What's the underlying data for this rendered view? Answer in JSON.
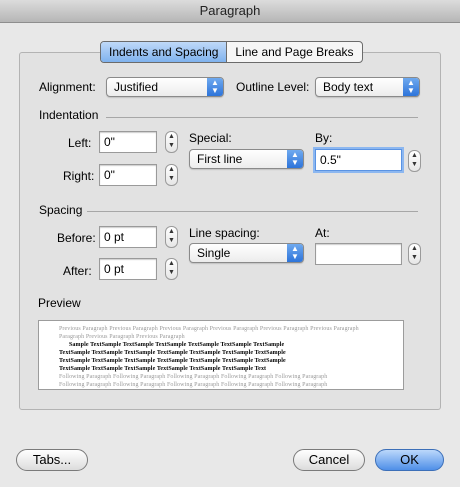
{
  "window": {
    "title": "Paragraph"
  },
  "tabs": [
    {
      "label": "Indents and Spacing",
      "selected": true
    },
    {
      "label": "Line and Page Breaks",
      "selected": false
    }
  ],
  "alignment": {
    "label": "Alignment:",
    "value": "Justified"
  },
  "outline_level": {
    "label": "Outline Level:",
    "value": "Body text"
  },
  "indentation": {
    "heading": "Indentation",
    "left": {
      "label": "Left:",
      "value": "0\""
    },
    "right": {
      "label": "Right:",
      "value": "0\""
    },
    "special": {
      "label": "Special:",
      "value": "First line"
    },
    "by": {
      "label": "By:",
      "value": "0.5\""
    }
  },
  "spacing": {
    "heading": "Spacing",
    "before": {
      "label": "Before:",
      "value": "0 pt"
    },
    "after": {
      "label": "After:",
      "value": "0 pt"
    },
    "line_spacing": {
      "label": "Line spacing:",
      "value": "Single"
    },
    "at": {
      "label": "At:",
      "value": ""
    }
  },
  "preview": {
    "heading": "Preview",
    "previous_lines": [
      "Previous Paragraph Previous Paragraph Previous Paragraph Previous Paragraph Previous Paragraph Previous Paragraph",
      "Paragraph Previous Paragraph Previous Paragraph"
    ],
    "sample_lines": [
      "Sample     TextSample     TextSample     TextSample     TextSample     TextSample     TextSample",
      "TextSample     TextSample     TextSample     TextSample     TextSample     TextSample     TextSample",
      "TextSample     TextSample     TextSample     TextSample     TextSample     TextSample     TextSample",
      "TextSample     TextSample     TextSample     TextSample     TextSample     TextSample     Text"
    ],
    "following_lines": [
      "Following Paragraph Following Paragraph Following Paragraph Following Paragraph Following Paragraph",
      "Following Paragraph Following Paragraph Following Paragraph Following Paragraph Following Paragraph",
      "Following Paragraph Following Paragraph Following Paragraph Following Paragraph Following Paragraph"
    ]
  },
  "buttons": {
    "tabs": "Tabs...",
    "cancel": "Cancel",
    "ok": "OK"
  }
}
